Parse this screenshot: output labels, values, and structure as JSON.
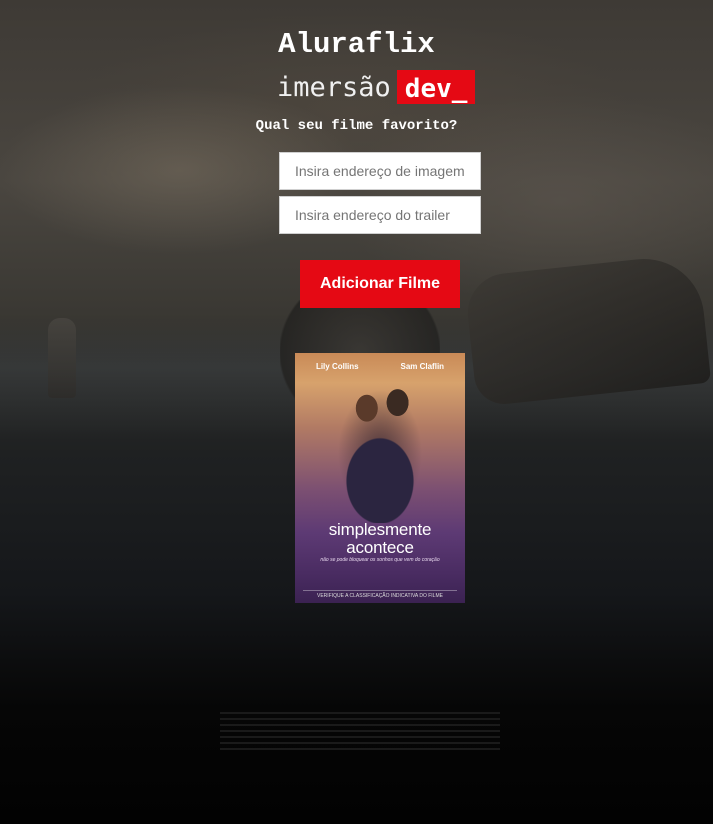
{
  "header": {
    "brand": "Aluraflix",
    "subtitle_prefix": "imersão",
    "subtitle_badge": "dev_",
    "question": "Qual seu filme favorito?"
  },
  "form": {
    "image_placeholder": "Insira endereço de imagem",
    "trailer_placeholder": "Insira endereço do trailer",
    "submit_label": "Adicionar Filme"
  },
  "movies": [
    {
      "title": "simplesmente acontece",
      "actors": [
        "Lily Collins",
        "Sam Claflin"
      ],
      "tagline": "não se pode bloquear os sonhos que vem do coração",
      "rating_note": "VERIFIQUE A CLASSIFICAÇÃO INDICATIVA DO FILME"
    }
  ],
  "colors": {
    "accent": "#e50914",
    "text": "#ffffff"
  }
}
